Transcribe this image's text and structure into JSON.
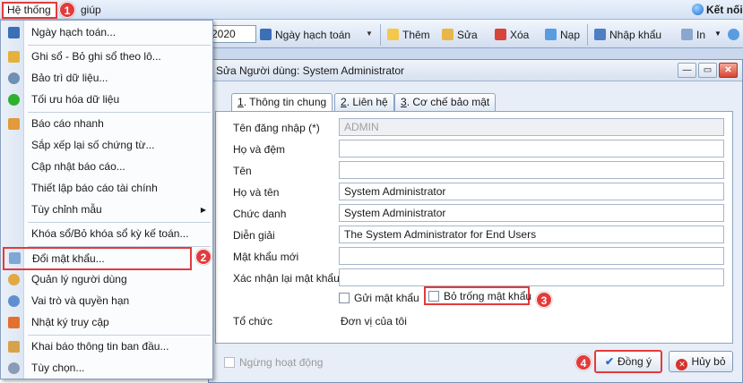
{
  "menubar": {
    "he_thong": "Hệ thống",
    "giup": "giúp",
    "ket_noi": "Kết nối"
  },
  "badges": [
    "1",
    "2",
    "3",
    "4"
  ],
  "toolbar": {
    "year_value": "2020",
    "ngay_hach_toan": "Ngày hạch toán",
    "them": "Thêm",
    "sua": "Sửa",
    "xoa": "Xóa",
    "nap": "Nạp",
    "nhap_khau": "Nhập khẩu",
    "in": "In"
  },
  "menu": {
    "items": [
      {
        "label": "Ngày hạch toán...",
        "icon": "calendar-icon"
      },
      {
        "label": "Ghi sổ - Bỏ ghi sổ theo lô...",
        "icon": "post-icon"
      },
      {
        "label": "Bảo trì dữ liệu...",
        "icon": "gear-icon"
      },
      {
        "label": "Tối ưu hóa dữ liệu",
        "icon": "green-dot-icon"
      },
      {
        "label": "Báo cáo nhanh",
        "icon": "report-icon"
      },
      {
        "label": "Sắp xếp lại số chứng từ...",
        "icon": ""
      },
      {
        "label": "Cập nhật báo cáo...",
        "icon": ""
      },
      {
        "label": "Thiết lập báo cáo tài chính",
        "icon": ""
      },
      {
        "label": "Tùy chỉnh mẫu",
        "icon": ""
      },
      {
        "label": "Khóa sổ/Bỏ khóa sổ kỳ kế toán...",
        "icon": ""
      },
      {
        "label": "Đổi mật khẩu...",
        "icon": "password-icon"
      },
      {
        "label": "Quản lý người dùng",
        "icon": "users-icon"
      },
      {
        "label": "Vai trò và quyền hạn",
        "icon": "role-icon"
      },
      {
        "label": "Nhật ký truy cập",
        "icon": "log-icon"
      },
      {
        "label": "Khai báo thông tin ban đầu...",
        "icon": "setup-icon"
      },
      {
        "label": "Tùy chọn...",
        "icon": "options-icon"
      }
    ]
  },
  "dialog": {
    "title": "Sửa Người dùng: System Administrator",
    "tabs": [
      {
        "num": "1",
        "label": ". Thông tin chung"
      },
      {
        "num": "2",
        "label": ". Liên hệ"
      },
      {
        "num": "3",
        "label": ". Cơ chế bảo mật"
      }
    ],
    "fields": {
      "ten_dang_nhap_label": "Tên đăng nhập (*)",
      "ten_dang_nhap_value": "ADMIN",
      "ho_dem_label": "Họ và đệm",
      "ho_dem_value": "",
      "ten_label": "Tên",
      "ten_value": "",
      "ho_ten_label": "Họ và tên",
      "ho_ten_value": "System Administrator",
      "chuc_danh_label": "Chức danh",
      "chuc_danh_value": "System Administrator",
      "dien_giai_label": "Diễn giải",
      "dien_giai_value": "The System Administrator for End Users",
      "mat_khau_moi_label": "Mật khẩu mới",
      "mat_khau_moi_value": "",
      "xac_nhan_label": "Xác nhận lại mật khẩu",
      "xac_nhan_value": "",
      "gui_mat_khau": "Gửi mật khẩu",
      "bo_trong_mat_khau": "Bỏ trống mật khẩu",
      "to_chuc_label": "Tổ chức",
      "to_chuc_value": "Đơn vị của tôi"
    },
    "ngung_hoat_dong": "Ngừng hoạt động",
    "ok_label": "Đồng ý",
    "cancel_label": "Hủy bỏ"
  }
}
